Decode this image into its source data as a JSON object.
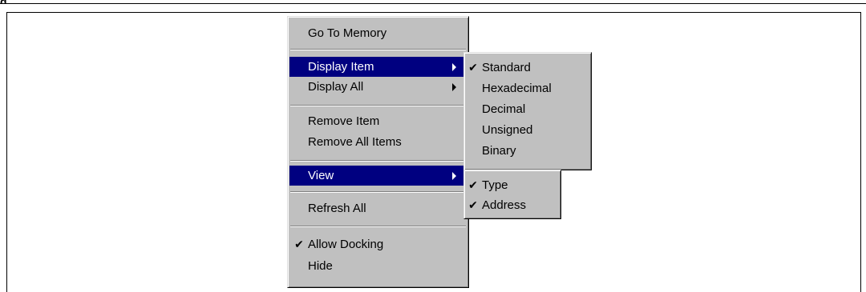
{
  "figure": {
    "heading_fragment": "g"
  },
  "context_menu": {
    "items": [
      {
        "label": "Go To Memory"
      },
      {
        "label": "Display Item",
        "highlighted": true,
        "submenu": true
      },
      {
        "label": "Display All",
        "submenu": true
      },
      {
        "label": "Remove Item"
      },
      {
        "label": "Remove All Items"
      },
      {
        "label": "View",
        "highlighted": true,
        "submenu": true
      },
      {
        "label": "Refresh All"
      },
      {
        "label": "Allow Docking",
        "checked": true
      },
      {
        "label": "Hide"
      }
    ]
  },
  "display_item_submenu": {
    "items": [
      {
        "label": "Standard",
        "checked": true
      },
      {
        "label": "Hexadecimal"
      },
      {
        "label": "Decimal"
      },
      {
        "label": "Unsigned"
      },
      {
        "label": "Binary"
      }
    ]
  },
  "view_submenu": {
    "items": [
      {
        "label": "Type",
        "checked": true
      },
      {
        "label": "Address",
        "checked": true
      }
    ]
  },
  "icons": {
    "check": "✔",
    "submenu_arrow": "triangle-right"
  },
  "colors": {
    "menu_bg": "#c0c0c0",
    "highlight_bg": "#000080",
    "highlight_text": "#ffffff"
  }
}
